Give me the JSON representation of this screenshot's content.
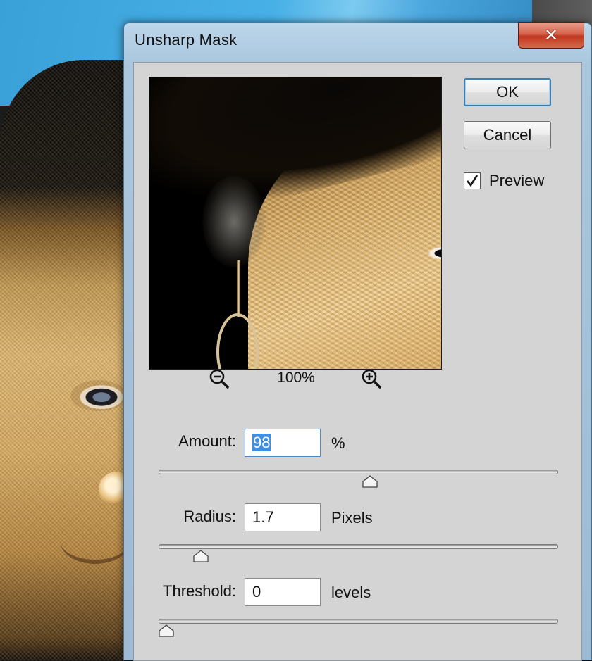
{
  "dialog": {
    "title": "Unsharp Mask",
    "close_symbol": "✕"
  },
  "preview": {
    "zoom_level": "100%",
    "zoom_out_icon": "zoom-out-icon",
    "zoom_in_icon": "zoom-in-icon"
  },
  "buttons": {
    "ok": "OK",
    "cancel": "Cancel"
  },
  "preview_toggle": {
    "label": "Preview",
    "checked": true
  },
  "params": {
    "amount": {
      "label": "Amount:",
      "value": "98",
      "unit": "%",
      "slider_fraction": 0.53
    },
    "radius": {
      "label": "Radius:",
      "value": "1.7",
      "unit": "Pixels",
      "slider_fraction": 0.09
    },
    "threshold": {
      "label": "Threshold:",
      "value": "0",
      "unit": "levels",
      "slider_fraction": 0.0
    }
  },
  "colors": {
    "close_button": "#d5624a",
    "title_bar": "#bcd6ea",
    "client_bg": "#d4d4d4",
    "selection": "#3f8ee0"
  }
}
